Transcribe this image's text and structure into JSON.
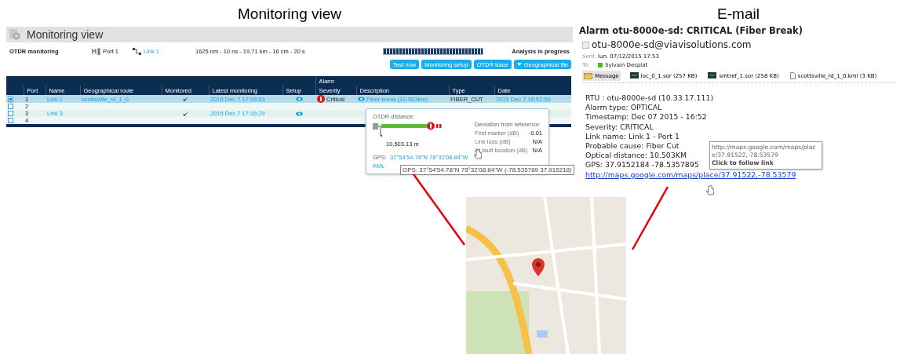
{
  "headings": [
    "Monitoring view",
    "E-mail"
  ],
  "monitoring": {
    "title": "Monitoring view",
    "mode": "OTDR monitoring",
    "port": "Port 1",
    "link": "Link 1",
    "settings": "1625 nm - 10 ns - 19.71 km - 16 cm - 20 s",
    "progress": {
      "level": 1
    },
    "status": "Analysis in progress",
    "buttons": [
      {
        "label": "Test now",
        "kind": "plain"
      },
      {
        "label": "Monitoring setup",
        "kind": "plain"
      },
      {
        "label": "OTDR trace",
        "kind": "plain"
      },
      {
        "label": "Geographical file",
        "kind": "dropdown"
      }
    ],
    "table": {
      "group_header": "Alarm",
      "columns": [
        "Port",
        "Name",
        "Geographical route",
        "Monitored",
        "Latest monitoring",
        "Setup",
        "Severity",
        "Description",
        "Type",
        "Date"
      ],
      "rows": [
        {
          "selected": true,
          "port": "1",
          "name": "Link 1",
          "route": "scottsville_rd_1_0",
          "monitored": true,
          "latest": "2015 Dec 7 17:16:53",
          "setup": true,
          "severity": "Critical",
          "description": "Fiber break (10.503km)",
          "type": "FIBER_CUT",
          "date": "2015 Dec 7 16:52:59"
        },
        {
          "selected": false,
          "port": "2",
          "monitored": false,
          "setup": false
        },
        {
          "selected": false,
          "port": "3",
          "name": "Link 3",
          "monitored": true,
          "latest": "2015 Dec 7 17:16:29",
          "setup": true
        },
        {
          "selected": false,
          "port": "4",
          "monitored": false,
          "setup": false
        }
      ]
    },
    "popup": {
      "distance_label": "OTDR distance:",
      "distance": "10,503.13 m",
      "deviation_title": "Deviation from reference:",
      "deviations": [
        {
          "label": "First marker (dB)",
          "value": "-0.01"
        },
        {
          "label": "Link loss (dB)",
          "value": "N/A"
        },
        {
          "label": "At fault location (dB)",
          "value": "N/A"
        }
      ],
      "gps_label": "GPS:",
      "gps": "37°54'54.78\"N 78°32'08.84\"W",
      "kml": "KML",
      "tooltip": "GPS: 37°54'54.78\"N 78°32'08.84\"W (-78.535789 37.915218)"
    }
  },
  "email": {
    "subject": "Alarm otu-8000e-sd: CRITICAL (Fiber Break)",
    "sender": "otu-8000e-sd@viavisolutions.com",
    "sent_label": "Sent:",
    "sent": "lun. 07/12/2015 17:53",
    "to_label": "To:",
    "to": "Sylvain Desplat",
    "tabs": [
      {
        "label": "Message",
        "kind": "message",
        "selected": true
      },
      {
        "label": "loc_0_1.sor (257 KB)",
        "kind": "trace",
        "selected": false
      },
      {
        "label": "smtref_1.sor (258 KB)",
        "kind": "trace",
        "selected": false
      },
      {
        "label": "scottsville_rd_1_0.kml (3 KB)",
        "kind": "file",
        "selected": false
      }
    ],
    "body": [
      "RTU : otu-8000e-sd (10.33.17.111)",
      "Alarm type: OPTICAL",
      "Timestamp: Dec 07 2015 - 16:52",
      "Severity: CRITICAL",
      "Link name: Link 1 - Port 1",
      "Probable cause: Fiber Cut",
      "Optical distance: 10.503KM",
      "GPS: 37.9152184 -78.5357895"
    ],
    "link": "http://maps.google.com/maps/place/37.91522,-78.53579",
    "tooltip": {
      "url": "http://maps.google.com/maps/place/37.91522,-78.53579",
      "hint": "Click to follow link"
    }
  }
}
